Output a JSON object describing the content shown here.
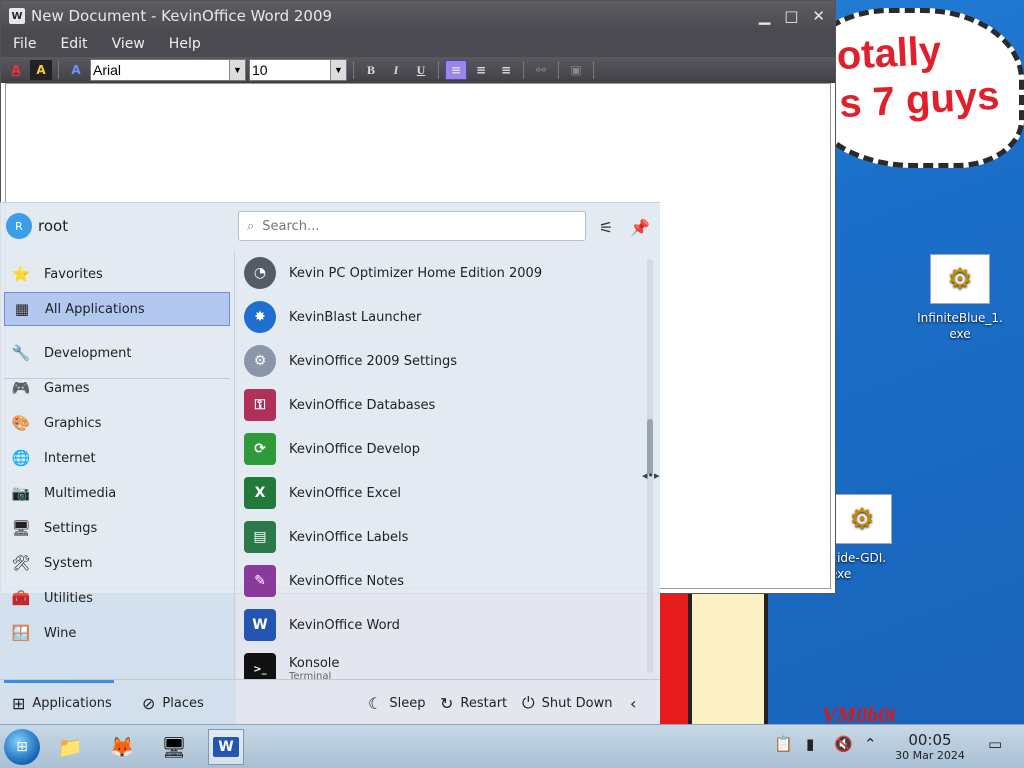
{
  "desktop": {
    "bubble_text": "otally\ns 7 guys",
    "signature": "VM0b0t",
    "icons": [
      {
        "label": "InfiniteBlue_1.\nexe"
      },
      {
        "label": "xide-GDI.\nexe"
      }
    ]
  },
  "word": {
    "title": "New Document - KevinOffice Word 2009",
    "title_icon": "W",
    "menu": [
      "File",
      "Edit",
      "View",
      "Help"
    ],
    "font": "Arial",
    "size": "10",
    "bold": "B",
    "italic": "I",
    "underline": "U"
  },
  "launcher": {
    "user": "root",
    "avatar_initial": "R",
    "search_placeholder": "Search...",
    "categories": [
      {
        "label": "Favorites",
        "icon": "star-icon"
      },
      {
        "label": "All Applications",
        "icon": "grid-icon",
        "selected": true
      },
      {
        "label": "Development",
        "icon": "tools-icon"
      },
      {
        "label": "Games",
        "icon": "joystick-icon"
      },
      {
        "label": "Graphics",
        "icon": "palette-icon"
      },
      {
        "label": "Internet",
        "icon": "globe-icon"
      },
      {
        "label": "Multimedia",
        "icon": "camera-icon"
      },
      {
        "label": "Settings",
        "icon": "settings-icon"
      },
      {
        "label": "System",
        "icon": "system-icon"
      },
      {
        "label": "Utilities",
        "icon": "utilities-icon"
      },
      {
        "label": "Wine",
        "icon": "wine-icon"
      }
    ],
    "apps": [
      {
        "label": "Kevin PC Optimizer Home Edition 2009",
        "icon": "gauge-icon",
        "color": "#555b66"
      },
      {
        "label": "KevinBlast Launcher",
        "icon": "burst-icon",
        "color": "#1f6fd0"
      },
      {
        "label": "KevinOffice 2009 Settings",
        "icon": "gear-icon",
        "color": "#8a97aa"
      },
      {
        "label": "KevinOffice Databases",
        "icon": "key-icon",
        "color": "#b0305a"
      },
      {
        "label": "KevinOffice Develop",
        "icon": "develop-icon",
        "color": "#2f9a3a"
      },
      {
        "label": "KevinOffice Excel",
        "icon": "excel-icon",
        "color": "#217a3a"
      },
      {
        "label": "KevinOffice Labels",
        "icon": "labels-icon",
        "color": "#2c7a4a"
      },
      {
        "label": "KevinOffice Notes",
        "icon": "notes-icon",
        "color": "#8a3a9a"
      },
      {
        "label": "KevinOffice Word",
        "icon": "word-icon",
        "color": "#2356b0"
      },
      {
        "label": "Konsole",
        "sublabel": "Terminal",
        "icon": "terminal-icon",
        "color": "#111111"
      }
    ],
    "tabs": [
      {
        "label": "Applications",
        "icon": "apps-grid-icon"
      },
      {
        "label": "Places",
        "icon": "compass-icon"
      }
    ],
    "power": [
      {
        "label": "Sleep",
        "icon": "sleep-icon"
      },
      {
        "label": "Restart",
        "icon": "restart-icon"
      },
      {
        "label": "Shut Down",
        "icon": "power-icon"
      }
    ]
  },
  "taskbar": {
    "time": "00:05",
    "date": "30 Mar 2024"
  },
  "colors": {
    "accent": "#3a8ee6",
    "selected_bg": "#b3c8ee",
    "desktop_blue": "#1b6fc9"
  }
}
